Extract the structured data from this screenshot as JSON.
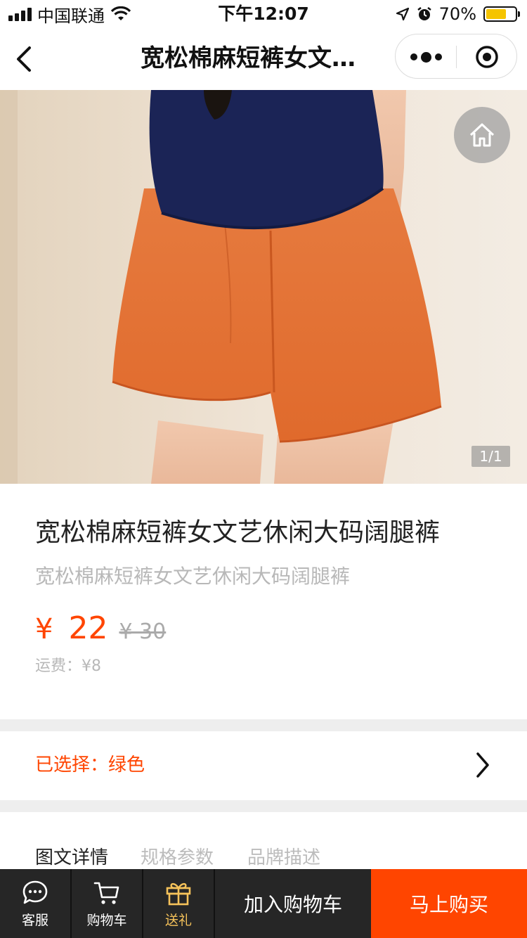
{
  "status_bar": {
    "carrier": "中国联通",
    "time": "下午12:07",
    "battery_percent": "70%",
    "battery_level": 0.7,
    "icons": [
      "signal-icon",
      "wifi-icon",
      "location-icon",
      "alarm-icon",
      "battery-icon"
    ]
  },
  "nav": {
    "title": "宽松棉麻短裤女文…",
    "icons": [
      "back-icon",
      "more-icon",
      "target-icon"
    ]
  },
  "gallery": {
    "counter": "1/1",
    "home_icon": "home-icon",
    "colors": {
      "background": "#e8dccb",
      "top": "#1a2350",
      "shorts": "#e8743a",
      "skin": "#eec3a8"
    }
  },
  "product": {
    "title": "宽松棉麻短裤女文艺休闲大码阔腿裤",
    "subtitle": "宽松棉麻短裤女文艺休闲大码阔腿裤",
    "currency": "¥",
    "price": "22",
    "original_price": "¥ 30",
    "shipping": "运费：¥8"
  },
  "selection": {
    "label": "已选择：绿色"
  },
  "tabs": [
    {
      "label": "图文详情",
      "active": true
    },
    {
      "label": "规格参数",
      "active": false
    },
    {
      "label": "品牌描述",
      "active": false
    }
  ],
  "bottom_bar": {
    "service": "客服",
    "cart": "购物车",
    "gift": "送礼",
    "add_to_cart": "加入购物车",
    "buy_now": "马上购买"
  },
  "colors": {
    "accent": "#ff4500",
    "bottom_bar": "#262626",
    "gift": "#f5c25a"
  }
}
